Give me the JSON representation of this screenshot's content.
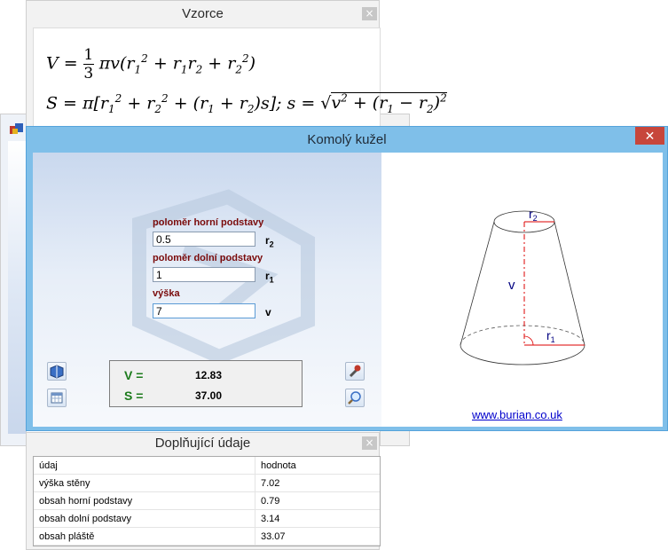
{
  "vzorce": {
    "title": "Vzorce",
    "close": "×"
  },
  "main": {
    "title": "Komolý kužel",
    "close": "✕",
    "fields": {
      "r2": {
        "label": "poloměr horní podstavy",
        "value": "0.5",
        "unit": "r",
        "unit_sub": "2"
      },
      "r1": {
        "label": "poloměr dolní podstavy",
        "value": "1",
        "unit": "r",
        "unit_sub": "1"
      },
      "v": {
        "label": "výška",
        "value": "7",
        "unit": "v"
      }
    },
    "results": {
      "V_label": "V =",
      "V_value": "12.83",
      "S_label": "S =",
      "S_value": "37.00"
    },
    "diagram": {
      "r2": "r",
      "r2_sub": "2",
      "r1": "r",
      "r1_sub": "1",
      "v": "v"
    },
    "link": "www.burian.co.uk",
    "icons": [
      "book-icon",
      "calculator-icon",
      "wrench-icon",
      "magnifier-icon"
    ]
  },
  "dopl": {
    "title": "Doplňující údaje",
    "close": "×",
    "headers": {
      "c1": "údaj",
      "c2": "hodnota"
    },
    "rows": [
      {
        "c1": "výška stěny",
        "c2": "7.02"
      },
      {
        "c1": "obsah horní podstavy",
        "c2": "0.79"
      },
      {
        "c1": "obsah dolní podstavy",
        "c2": "3.14"
      },
      {
        "c1": "obsah pláště",
        "c2": "33.07"
      }
    ]
  },
  "colors": {
    "accent": "#7fbfe9",
    "close_red": "#c7463b",
    "label_red": "#7a0a0a",
    "result_green": "#1b7a1b",
    "link_blue": "#0000cc"
  }
}
